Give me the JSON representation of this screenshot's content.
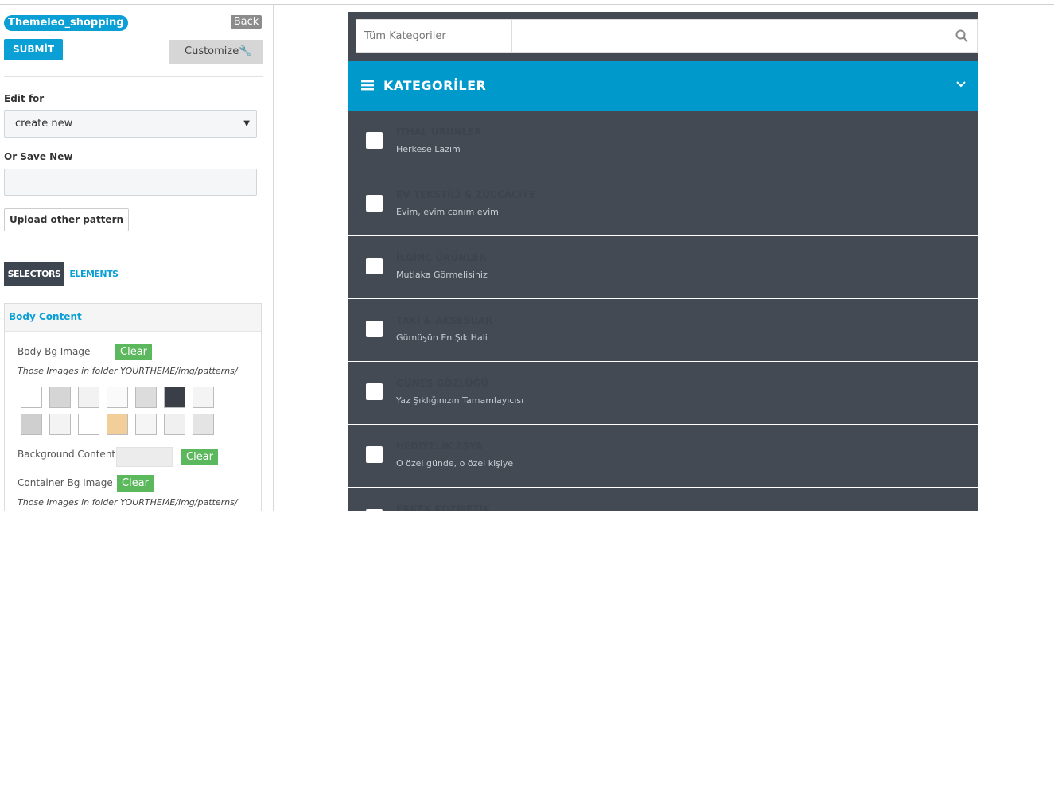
{
  "sidebar": {
    "theme_name": "Themeleo_shopping",
    "back_label": "Back",
    "submit_label": "SUBMİT",
    "customize_label": "Customize",
    "edit_for_label": "Edit for",
    "edit_for_value": "create new",
    "save_new_label": "Or Save New",
    "upload_label": "Upload other pattern",
    "tabs": [
      {
        "label": "SELECTORS",
        "active": true
      },
      {
        "label": "ELEMENTS",
        "active": false
      }
    ],
    "panel": {
      "title": "Body Content",
      "body_bg_label": "Body Bg Image",
      "clear_label": "Clear",
      "patterns_note": "Those Images in folder YOURTHEME/img/patterns/",
      "bg_content_label": "Background Content",
      "container_bg_label": "Container Bg Image"
    },
    "patterns": [
      "#ffffff",
      "#d5d5d5",
      "#f2f2f2",
      "#fafafa",
      "#dcdcdc",
      "#3a3f47",
      "#f4f4f4",
      "#cfcfcf",
      "#f3f3f3",
      "#ffffff",
      "#f2cf99",
      "#f5f5f5",
      "#f0f0f0",
      "#e4e4e4"
    ]
  },
  "preview": {
    "search": {
      "category": "Tüm Kategoriler"
    },
    "header": "KATEGORİLER",
    "categories": [
      {
        "name": "İTHAL ÜRÜNLER",
        "sub": "Herkese Lazım",
        "icon": "globe-icon"
      },
      {
        "name": "EV TEKSTİLİ & ZÜCCACİYE",
        "sub": "Evim, evim canım evim",
        "icon": "bowl-icon"
      },
      {
        "name": "İLGİNÇ ÜRÜNLER",
        "sub": "Mutlaka Görmelisiniz",
        "icon": "book-icon"
      },
      {
        "name": "TAKI & AKSESUAR",
        "sub": "Gümüşün En Şık Hali",
        "icon": "jewel-icon"
      },
      {
        "name": "GÜNEŞ GÖZLÜĞÜ",
        "sub": "Yaz Şıklığınızın Tamamlayıcısı",
        "icon": "glasses-icon"
      },
      {
        "name": "HEDİYELİK EŞYA",
        "sub": "O özel günde, o özel kişiye",
        "icon": "gift-icon"
      },
      {
        "name": "ERKEK KOZMETİK",
        "sub": "",
        "icon": "item-icon"
      }
    ]
  },
  "colors": {
    "accent": "#0099cc",
    "dark": "#444a54",
    "clear_green": "#5cb85c"
  }
}
